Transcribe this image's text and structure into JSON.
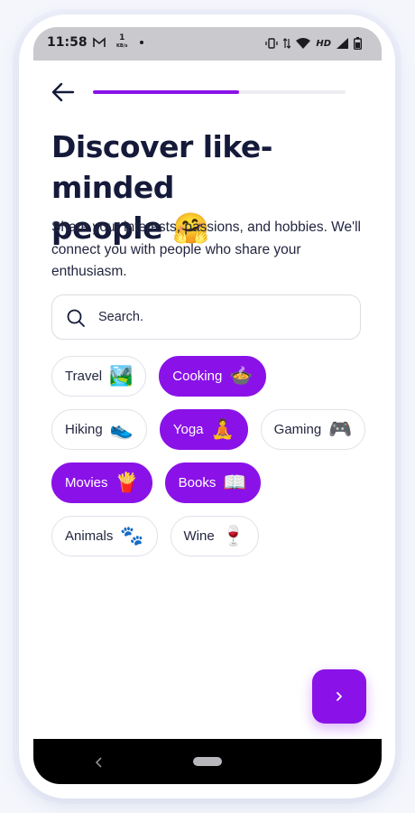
{
  "status_bar": {
    "time": "11:58",
    "kbs_value": "1",
    "kbs_unit": "KB/s",
    "network_label": "HD"
  },
  "progress": {
    "fraction": 0.58
  },
  "title_line1": "Discover like-minded",
  "title_line2": "people 🤗",
  "subtitle": "Share your interests, passions, and hobbies. We'll connect you with people who share your enthusiasm.",
  "search": {
    "placeholder": "Search."
  },
  "interests": [
    [
      {
        "label": "Travel",
        "emoji": "🏞️",
        "selected": false
      },
      {
        "label": "Cooking",
        "emoji": "🍲",
        "selected": true
      }
    ],
    [
      {
        "label": "Hiking",
        "emoji": "👟",
        "selected": false
      },
      {
        "label": "Yoga",
        "emoji": "🧘",
        "selected": true
      },
      {
        "label": "Gaming",
        "emoji": "🎮",
        "selected": false
      }
    ],
    [
      {
        "label": "Movies",
        "emoji": "🍟",
        "selected": true
      },
      {
        "label": "Books",
        "emoji": "📖",
        "selected": true
      }
    ],
    [
      {
        "label": "Animals",
        "emoji": "🐾",
        "selected": false
      },
      {
        "label": "Wine",
        "emoji": "🍷",
        "selected": false
      }
    ]
  ],
  "colors": {
    "accent": "#8a12e8",
    "title": "#151a3a",
    "text": "#23263f"
  },
  "icons": {
    "back": "arrow-left-icon",
    "search": "search-icon",
    "next": "chevron-right-icon"
  }
}
